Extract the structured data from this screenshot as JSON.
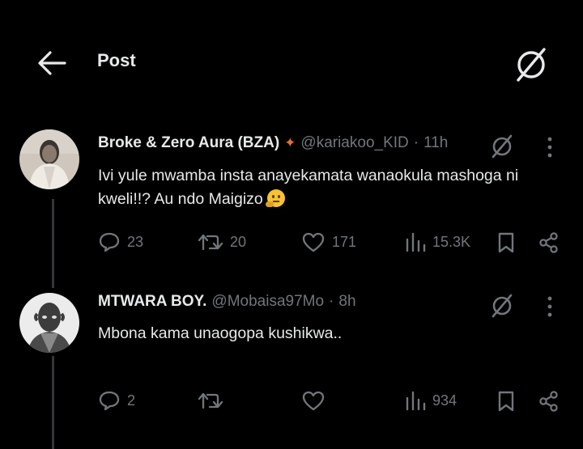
{
  "header": {
    "title": "Post"
  },
  "replies": [
    {
      "name": "Broke & Zero Aura (BZA)",
      "badge": "🍁",
      "handle": "@kariakoo_KID",
      "sep": "·",
      "time": "11h",
      "text_line1": "Ivi yule mwamba insta anayekamata wanaokula mashoga ni",
      "text_line2": "kweli!!? Au ndo Maigizo",
      "emoji": "thinking-face",
      "replies": "23",
      "reposts": "20",
      "likes": "171",
      "views": "15.3K"
    },
    {
      "name": "MTWARA BOY.",
      "handle": "@Mobaisa97Mo",
      "sep": "·",
      "time": "8h",
      "text_line1": "Mbona kama unaogopa kushikwa..",
      "replies": "2",
      "reposts": "",
      "likes": "",
      "views": "934"
    }
  ],
  "colors": {
    "background": "#000000",
    "text": "#e7e9ea",
    "muted": "#71767b",
    "thread": "#333639",
    "maple": "#e0703a"
  },
  "icons": [
    "back-arrow-icon",
    "grok-icon",
    "more-icon",
    "reply-icon",
    "repost-icon",
    "like-icon",
    "views-icon",
    "bookmark-icon",
    "share-icon"
  ]
}
